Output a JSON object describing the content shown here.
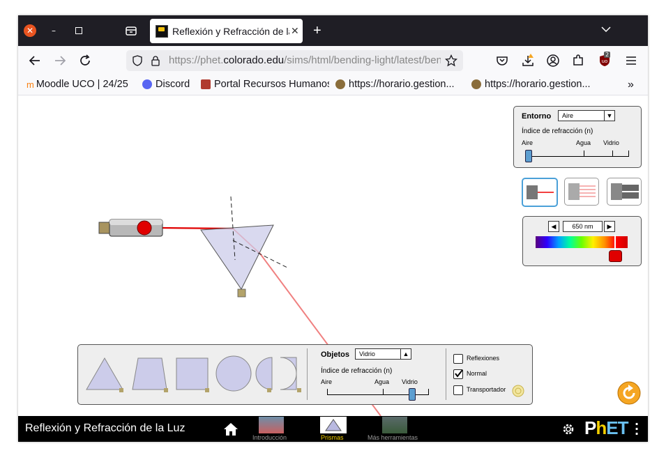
{
  "browser": {
    "tab_title": "Reflexión y Refracción de la Luz",
    "url_prefix": "https://phet.",
    "url_domain": "colorado.edu",
    "url_path": "/sims/html/bending-light/latest/bending-light_es.html",
    "extension_badge": "2",
    "bookmarks": [
      "Moodle UCO | 24/25",
      "Discord",
      "Portal Recursos Humanos",
      "https://horario.gestion...",
      "https://horario.gestion..."
    ]
  },
  "sim": {
    "environment_panel": {
      "title": "Entorno",
      "selected": "Aire",
      "index_label": "Índice de refracción (n)",
      "ticks": [
        "Aire",
        "Agua",
        "Vidrio"
      ]
    },
    "wavelength": {
      "value": "650 nm"
    },
    "objects_panel": {
      "title": "Objetos",
      "selected": "Vidrio",
      "index_label": "Índice de refracción (n)",
      "ticks": [
        "Aire",
        "Agua",
        "Vidrio"
      ]
    },
    "checkboxes": [
      {
        "label": "Reflexiones",
        "checked": false
      },
      {
        "label": "Normal",
        "checked": true
      },
      {
        "label": "Transportador",
        "checked": false
      }
    ]
  },
  "footer": {
    "title": "Reflexión y Refracción de la Luz",
    "screens": [
      "Introducción",
      "Prismas",
      "Más herramientas"
    ],
    "active_screen": "Prismas",
    "logo": "PhET"
  },
  "colors": {
    "accent_orange": "#f5a623",
    "laser_red": "#e00000",
    "selected_blue": "#4aa0d8",
    "tabbar": "#1f1e25"
  }
}
